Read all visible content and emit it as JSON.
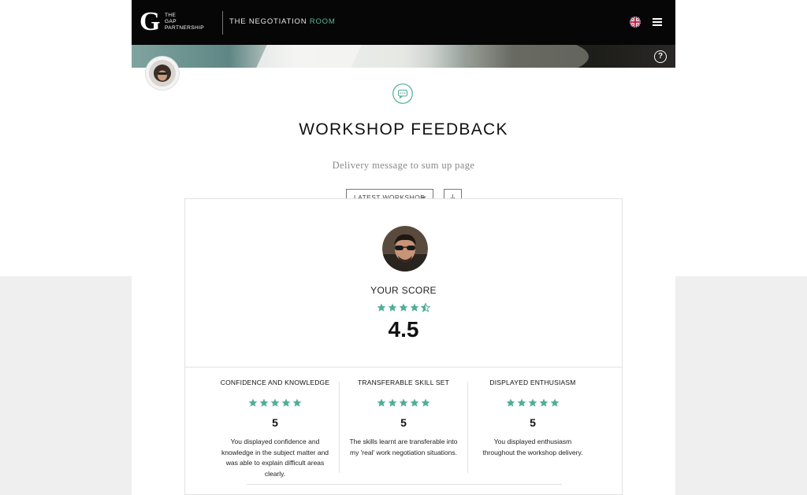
{
  "header": {
    "logo_letter": "G",
    "logo_lines": [
      "THE",
      "GAP",
      "PARTNERSHIP"
    ],
    "product_prefix": "THE NEGOTIATION ",
    "product_accent": "ROOM",
    "language_icon": "uk-flag-icon",
    "menu_icon": "hamburger-menu-icon",
    "help_symbol": "?"
  },
  "page": {
    "title": "WORKSHOP FEEDBACK",
    "subtitle": "Delivery message to sum up page",
    "icon": "chat-bubble-icon"
  },
  "controls": {
    "workshop_select": "LATEST WORKSHOP",
    "chevron": "⌄",
    "download_icon": "download-icon"
  },
  "score": {
    "label": "YOUR SCORE",
    "value": "4.5",
    "rating": 4.5,
    "max": 5
  },
  "categories": [
    {
      "title": "CONFIDENCE AND KNOWLEDGE",
      "rating": 5,
      "value": "5",
      "description": "You displayed confidence and knowledge in the subject matter and was able to explain difficult areas clearly."
    },
    {
      "title": "TRANSFERABLE SKILL SET",
      "rating": 5,
      "value": "5",
      "description": "The skills learnt are transferable into my 'real' work negotiation situations."
    },
    {
      "title": "DISPLAYED ENTHUSIASM",
      "rating": 5,
      "value": "5",
      "description": "You displayed enthusiasm throughout the workshop delivery."
    }
  ],
  "colors": {
    "accent": "#4fae95",
    "header_bg": "#060606"
  }
}
